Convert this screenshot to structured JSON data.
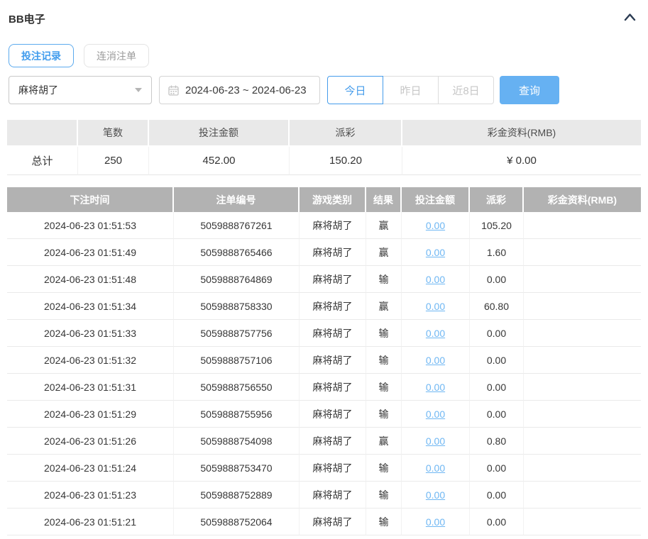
{
  "panel": {
    "title": "BB电子"
  },
  "tabs": [
    {
      "label": "投注记录",
      "active": true
    },
    {
      "label": "连消注单",
      "active": false
    }
  ],
  "filters": {
    "game_select": {
      "value": "麻将胡了"
    },
    "date_range": "2024-06-23 ~ 2024-06-23",
    "quick_buttons": [
      {
        "label": "今日",
        "active": true
      },
      {
        "label": "昨日",
        "active": false
      },
      {
        "label": "近8日",
        "active": false
      }
    ],
    "query_label": "查询"
  },
  "summary": {
    "headers": [
      "",
      "笔数",
      "投注金额",
      "派彩",
      "彩金资料(RMB)"
    ],
    "row_label": "总计",
    "count": "250",
    "bet_amount": "452.00",
    "payout": "150.20",
    "bonus": "¥ 0.00"
  },
  "records": {
    "headers": [
      "下注时间",
      "注单编号",
      "游戏类别",
      "结果",
      "投注金额",
      "派彩",
      "彩金资料(RMB)"
    ],
    "rows": [
      {
        "time": "2024-06-23 01:51:53",
        "bet_id": "5059888767261",
        "game": "麻将胡了",
        "result": "赢",
        "bet_amount": "0.00",
        "payout": "105.20",
        "bonus": ""
      },
      {
        "time": "2024-06-23 01:51:49",
        "bet_id": "5059888765466",
        "game": "麻将胡了",
        "result": "赢",
        "bet_amount": "0.00",
        "payout": "1.60",
        "bonus": ""
      },
      {
        "time": "2024-06-23 01:51:48",
        "bet_id": "5059888764869",
        "game": "麻将胡了",
        "result": "输",
        "bet_amount": "0.00",
        "payout": "0.00",
        "bonus": ""
      },
      {
        "time": "2024-06-23 01:51:34",
        "bet_id": "5059888758330",
        "game": "麻将胡了",
        "result": "赢",
        "bet_amount": "0.00",
        "payout": "60.80",
        "bonus": ""
      },
      {
        "time": "2024-06-23 01:51:33",
        "bet_id": "5059888757756",
        "game": "麻将胡了",
        "result": "输",
        "bet_amount": "0.00",
        "payout": "0.00",
        "bonus": ""
      },
      {
        "time": "2024-06-23 01:51:32",
        "bet_id": "5059888757106",
        "game": "麻将胡了",
        "result": "输",
        "bet_amount": "0.00",
        "payout": "0.00",
        "bonus": ""
      },
      {
        "time": "2024-06-23 01:51:31",
        "bet_id": "5059888756550",
        "game": "麻将胡了",
        "result": "输",
        "bet_amount": "0.00",
        "payout": "0.00",
        "bonus": ""
      },
      {
        "time": "2024-06-23 01:51:29",
        "bet_id": "5059888755956",
        "game": "麻将胡了",
        "result": "输",
        "bet_amount": "0.00",
        "payout": "0.00",
        "bonus": ""
      },
      {
        "time": "2024-06-23 01:51:26",
        "bet_id": "5059888754098",
        "game": "麻将胡了",
        "result": "赢",
        "bet_amount": "0.00",
        "payout": "0.80",
        "bonus": ""
      },
      {
        "time": "2024-06-23 01:51:24",
        "bet_id": "5059888753470",
        "game": "麻将胡了",
        "result": "输",
        "bet_amount": "0.00",
        "payout": "0.00",
        "bonus": ""
      },
      {
        "time": "2024-06-23 01:51:23",
        "bet_id": "5059888752889",
        "game": "麻将胡了",
        "result": "输",
        "bet_amount": "0.00",
        "payout": "0.00",
        "bonus": ""
      },
      {
        "time": "2024-06-23 01:51:21",
        "bet_id": "5059888752064",
        "game": "麻将胡了",
        "result": "输",
        "bet_amount": "0.00",
        "payout": "0.00",
        "bonus": ""
      }
    ]
  },
  "colors": {
    "accent_blue": "#459ceb",
    "link_blue": "#6fb7f3",
    "query_button_bg": "#66b1f2",
    "table_header_bg": "#b2b2b2",
    "summary_header_bg": "#e9e9e9",
    "disabled_text": "#c7c7c7"
  }
}
